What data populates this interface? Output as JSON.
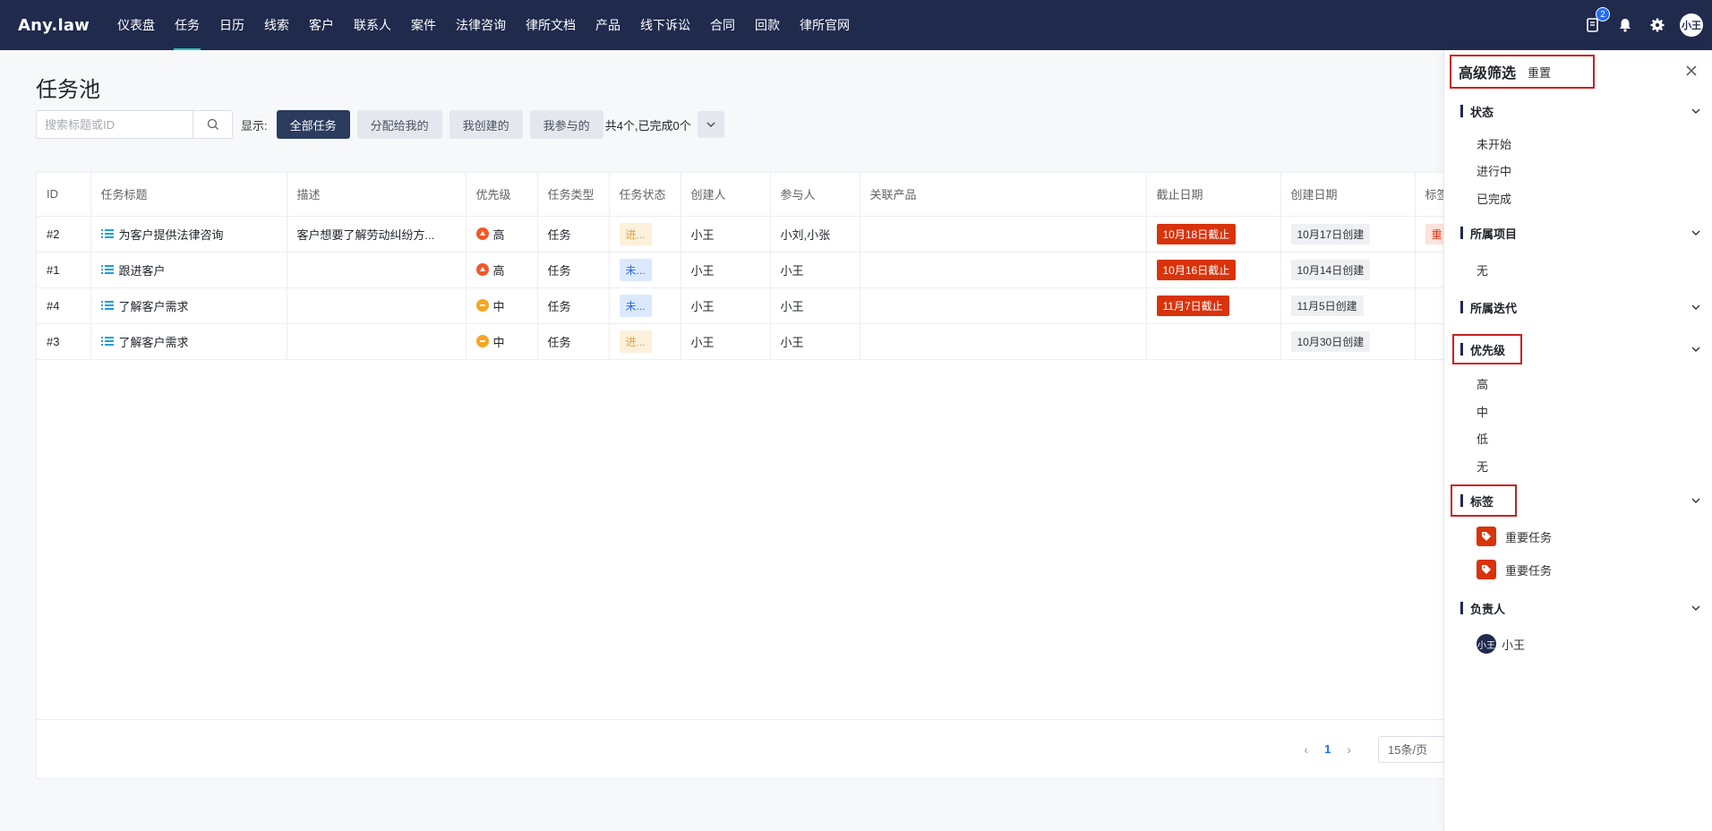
{
  "app": {
    "logo": "Any.law"
  },
  "nav": {
    "items": [
      "仪表盘",
      "任务",
      "日历",
      "线索",
      "客户",
      "联系人",
      "案件",
      "法律咨询",
      "律所文档",
      "产品",
      "线下诉讼",
      "合同",
      "回款",
      "律所官网"
    ],
    "active": "任务",
    "notification_count": "2",
    "user_avatar": "小王"
  },
  "page": {
    "title": "任务池"
  },
  "toolbar": {
    "search_placeholder": "搜索标题或ID",
    "show_label": "显示:",
    "filters": [
      "全部任务",
      "分配给我的",
      "我创建的",
      "我参与的"
    ],
    "active_filter": "全部任务",
    "summary": "共4个,已完成0个"
  },
  "table": {
    "columns": [
      "ID",
      "任务标题",
      "描述",
      "优先级",
      "任务类型",
      "任务状态",
      "创建人",
      "参与人",
      "关联产品",
      "截止日期",
      "创建日期",
      "标签"
    ],
    "rows": [
      {
        "id": "#2",
        "title": "为客户提供法律咨询",
        "desc": "客户想要了解劳动纠纷方...",
        "priority": "高",
        "type": "任务",
        "status": "进...",
        "creator": "小王",
        "participants": "小刘,小张",
        "product": "",
        "deadline": "10月18日截止",
        "created": "10月17日创建",
        "tag": "重"
      },
      {
        "id": "#1",
        "title": "跟进客户",
        "desc": "",
        "priority": "高",
        "type": "任务",
        "status": "未...",
        "creator": "小王",
        "participants": "小王",
        "product": "",
        "deadline": "10月16日截止",
        "created": "10月14日创建",
        "tag": ""
      },
      {
        "id": "#4",
        "title": "了解客户需求",
        "desc": "",
        "priority": "中",
        "type": "任务",
        "status": "未...",
        "creator": "小王",
        "participants": "小王",
        "product": "",
        "deadline": "11月7日截止",
        "created": "11月5日创建",
        "tag": ""
      },
      {
        "id": "#3",
        "title": "了解客户需求",
        "desc": "",
        "priority": "中",
        "type": "任务",
        "status": "进...",
        "creator": "小王",
        "participants": "小王",
        "product": "",
        "deadline": "",
        "created": "10月30日创建",
        "tag": ""
      }
    ]
  },
  "pagination": {
    "prev": "‹",
    "current": "1",
    "next": "›",
    "page_size": "15条/页"
  },
  "filter_panel": {
    "title": "高级筛选",
    "reset": "重置",
    "sections": {
      "status": {
        "label": "状态",
        "options": [
          "未开始",
          "进行中",
          "已完成"
        ]
      },
      "project": {
        "label": "所属项目",
        "options": [
          "无"
        ]
      },
      "iteration": {
        "label": "所属迭代",
        "options": []
      },
      "priority": {
        "label": "优先级",
        "options": [
          "高",
          "中",
          "低",
          "无"
        ]
      },
      "tags": {
        "label": "标签",
        "options": [
          "重要任务",
          "重要任务"
        ]
      },
      "assignee": {
        "label": "负责人",
        "options": [
          "小王"
        ],
        "avatar": "小王"
      }
    }
  },
  "colors": {
    "nav_bg": "#1f2a4d",
    "active_underline": "#2ec4b6",
    "deadline": "#d9330c",
    "priority_high": "#f05a28",
    "priority_mid": "#f5a623",
    "highlight": "#cc1f1f"
  }
}
